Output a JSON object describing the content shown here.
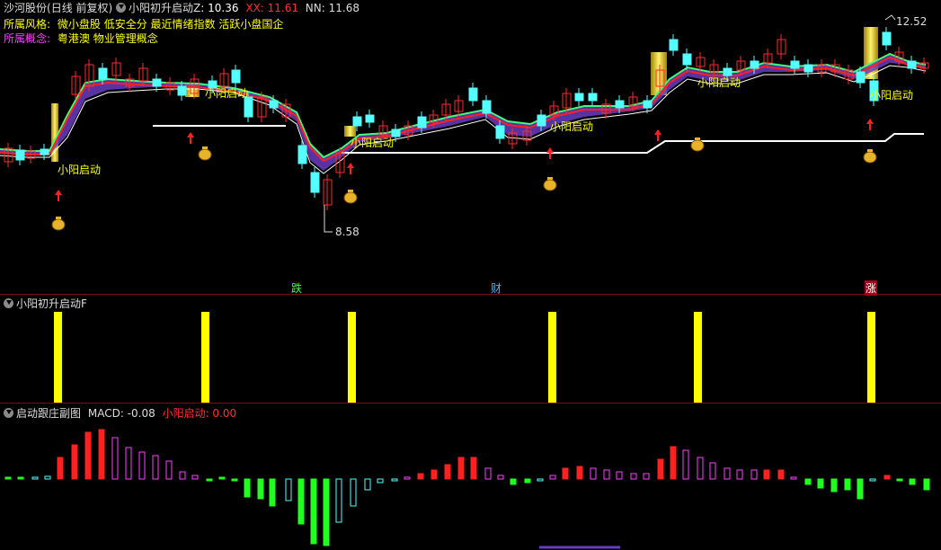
{
  "main": {
    "stock_name": "沙河股份",
    "period": "(日线 前复权)",
    "indicator_name": "小阳初升启动Z",
    "indicator_value": ": 10.36",
    "xx_label": "XX: 11.61",
    "nn_label": "NN: 11.68",
    "style_label": "所属风格:",
    "style_value": "微小盘股 低安全分 最近情绪指数 活跃小盘国企",
    "concept_label": "所属概念:",
    "concept_value": "粤港澳 物业管理概念",
    "signal_text": "小阳启动",
    "high_price": "12.52",
    "low_price": "8.58",
    "marker_die": "跌",
    "marker_cai": "财",
    "marker_zhang": "涨",
    "colors": {
      "up": "#ff2a2a",
      "down": "#54ffff",
      "signal": "#ffff00"
    }
  },
  "sub1": {
    "title": "小阳初升启动F"
  },
  "sub2": {
    "title": "启动跟庄副图",
    "macd_label": "MACD: -0.08",
    "signal_label": "小阳启动: 0.00"
  }
}
